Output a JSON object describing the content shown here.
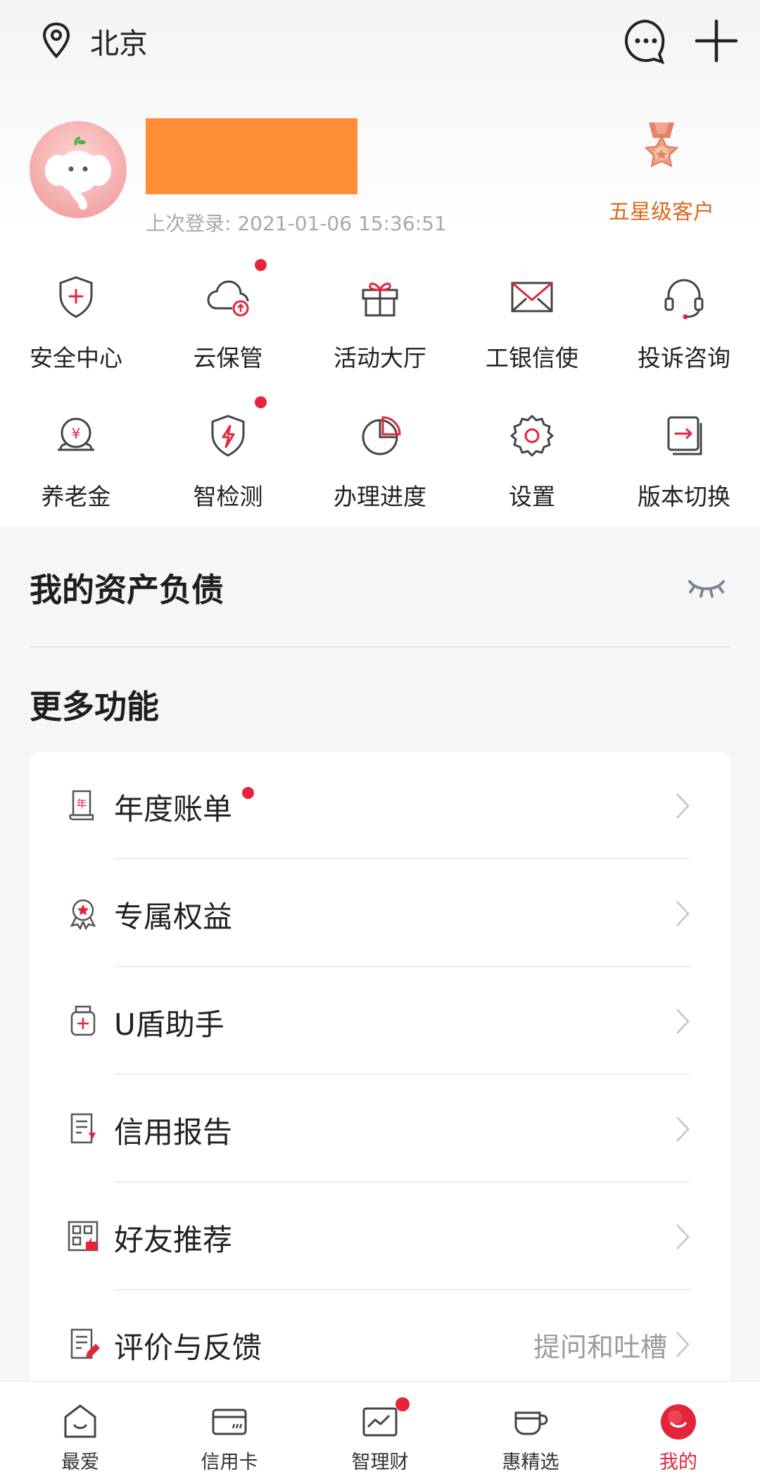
{
  "header": {
    "location_icon": "location-pin-icon",
    "city": "北京",
    "message_icon": "chat-bubble-icon",
    "add_icon": "plus-icon"
  },
  "profile": {
    "last_login": "上次登录: 2021-01-06 15:36:51",
    "level_label": "五星级客户",
    "level_icon": "medal-icon"
  },
  "shortcuts": [
    {
      "label": "安全中心",
      "icon": "shield-plus-icon",
      "badge": false
    },
    {
      "label": "云保管",
      "icon": "cloud-upload-icon",
      "badge": true
    },
    {
      "label": "活动大厅",
      "icon": "gift-icon",
      "badge": false
    },
    {
      "label": "工银信使",
      "icon": "envelope-icon",
      "badge": false
    },
    {
      "label": "投诉咨询",
      "icon": "headset-icon",
      "badge": false
    },
    {
      "label": "养老金",
      "icon": "pension-coin-icon",
      "badge": false
    },
    {
      "label": "智检测",
      "icon": "shield-bolt-icon",
      "badge": true
    },
    {
      "label": "办理进度",
      "icon": "pie-progress-icon",
      "badge": false
    },
    {
      "label": "设置",
      "icon": "gear-icon",
      "badge": false
    },
    {
      "label": "版本切换",
      "icon": "switch-version-icon",
      "badge": false
    }
  ],
  "assets": {
    "title": "我的资产负债",
    "visibility_icon": "eye-closed-icon"
  },
  "more": {
    "title": "更多功能",
    "items": [
      {
        "label": "年度账单",
        "icon": "annual-bill-icon",
        "badge": true,
        "extra": ""
      },
      {
        "label": "专属权益",
        "icon": "award-ribbon-icon",
        "badge": false,
        "extra": ""
      },
      {
        "label": "U盾助手",
        "icon": "usb-key-icon",
        "badge": false,
        "extra": ""
      },
      {
        "label": "信用报告",
        "icon": "credit-report-icon",
        "badge": false,
        "extra": ""
      },
      {
        "label": "好友推荐",
        "icon": "qr-like-icon",
        "badge": false,
        "extra": ""
      },
      {
        "label": "评价与反馈",
        "icon": "feedback-edit-icon",
        "badge": false,
        "extra": "提问和吐槽"
      }
    ]
  },
  "tabbar": [
    {
      "label": "最爱",
      "icon": "home-smile-icon",
      "active": false,
      "badge": false
    },
    {
      "label": "信用卡",
      "icon": "credit-card-icon",
      "active": false,
      "badge": false
    },
    {
      "label": "智理财",
      "icon": "trend-chart-icon",
      "active": false,
      "badge": true
    },
    {
      "label": "惠精选",
      "icon": "coffee-cup-icon",
      "active": false,
      "badge": false
    },
    {
      "label": "我的",
      "icon": "smile-circle-icon",
      "active": true,
      "badge": false
    }
  ],
  "colors": {
    "accent_red": "#e5243a",
    "level_orange": "#d96a20",
    "mask_orange": "#ff8c36"
  }
}
